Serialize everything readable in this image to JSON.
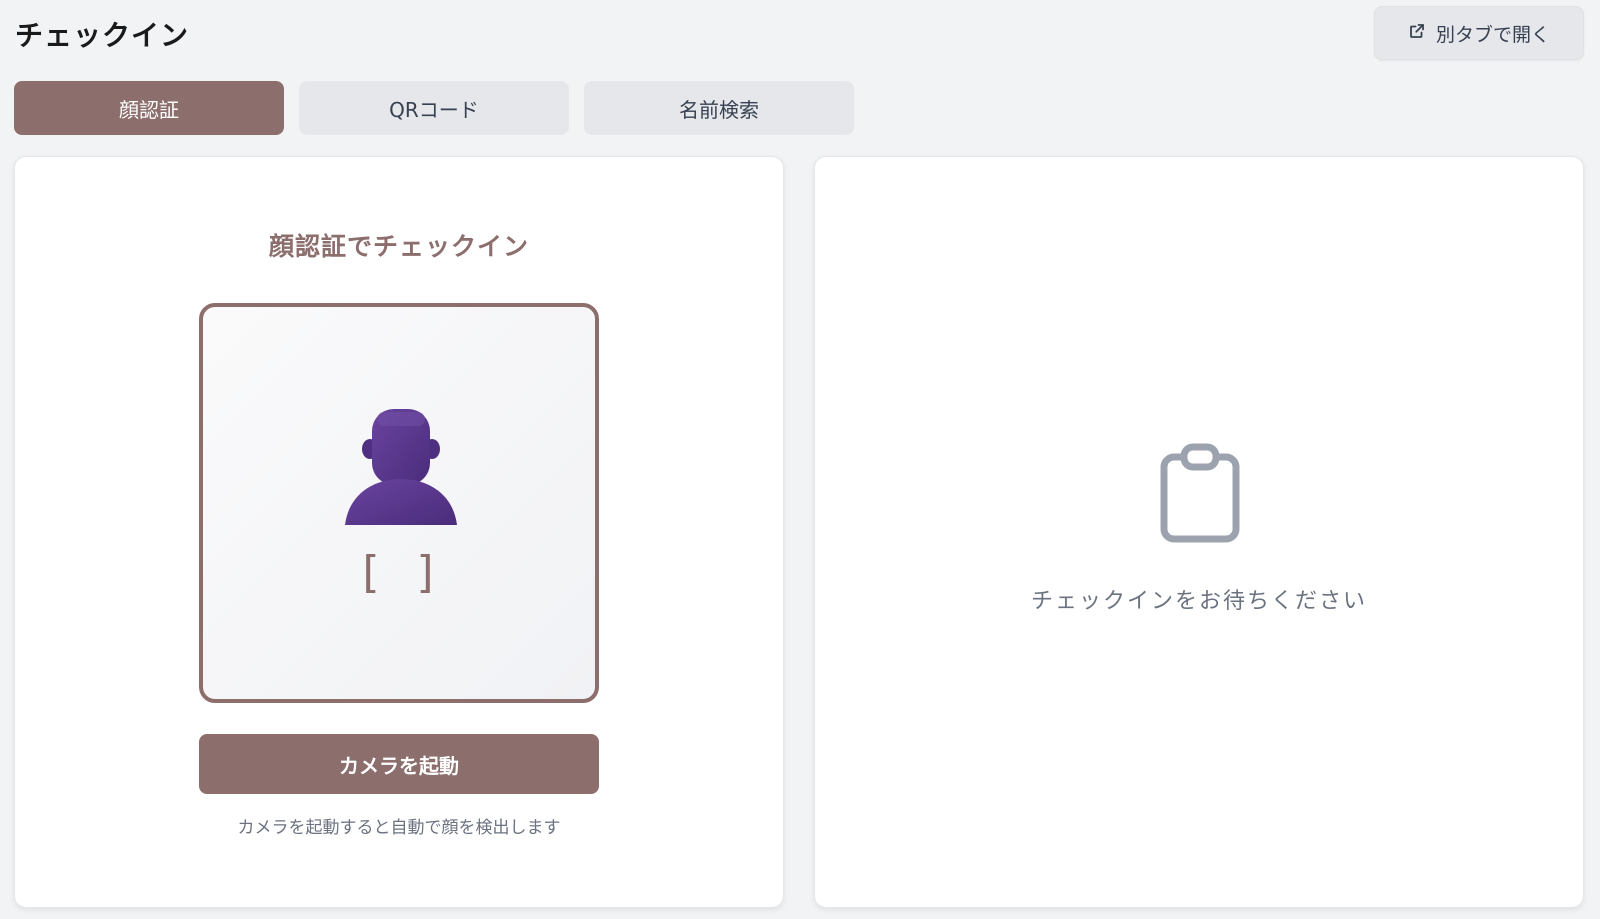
{
  "header": {
    "title": "チェックイン",
    "open_tab_label": "別タブで開く",
    "open_tab_icon": "external-link-icon"
  },
  "tabs": [
    {
      "label": "顔認証",
      "active": true
    },
    {
      "label": "QRコード",
      "active": false
    },
    {
      "label": "名前検索",
      "active": false
    }
  ],
  "face_panel": {
    "title": "顔認証でチェックイン",
    "placeholder_icon": "person-icon",
    "bracket_text": "[ ]",
    "camera_button_label": "カメラを起動",
    "hint": "カメラを起動すると自動で顔を検出します"
  },
  "status_panel": {
    "icon": "clipboard-icon",
    "waiting_text": "チェックインをお待ちください"
  },
  "colors": {
    "accent": "#8c6e6d",
    "tab_inactive": "#e5e7eb",
    "background": "#f2f3f5",
    "person_icon": "#5b3a8c",
    "clipboard_icon": "#9ca3af"
  }
}
